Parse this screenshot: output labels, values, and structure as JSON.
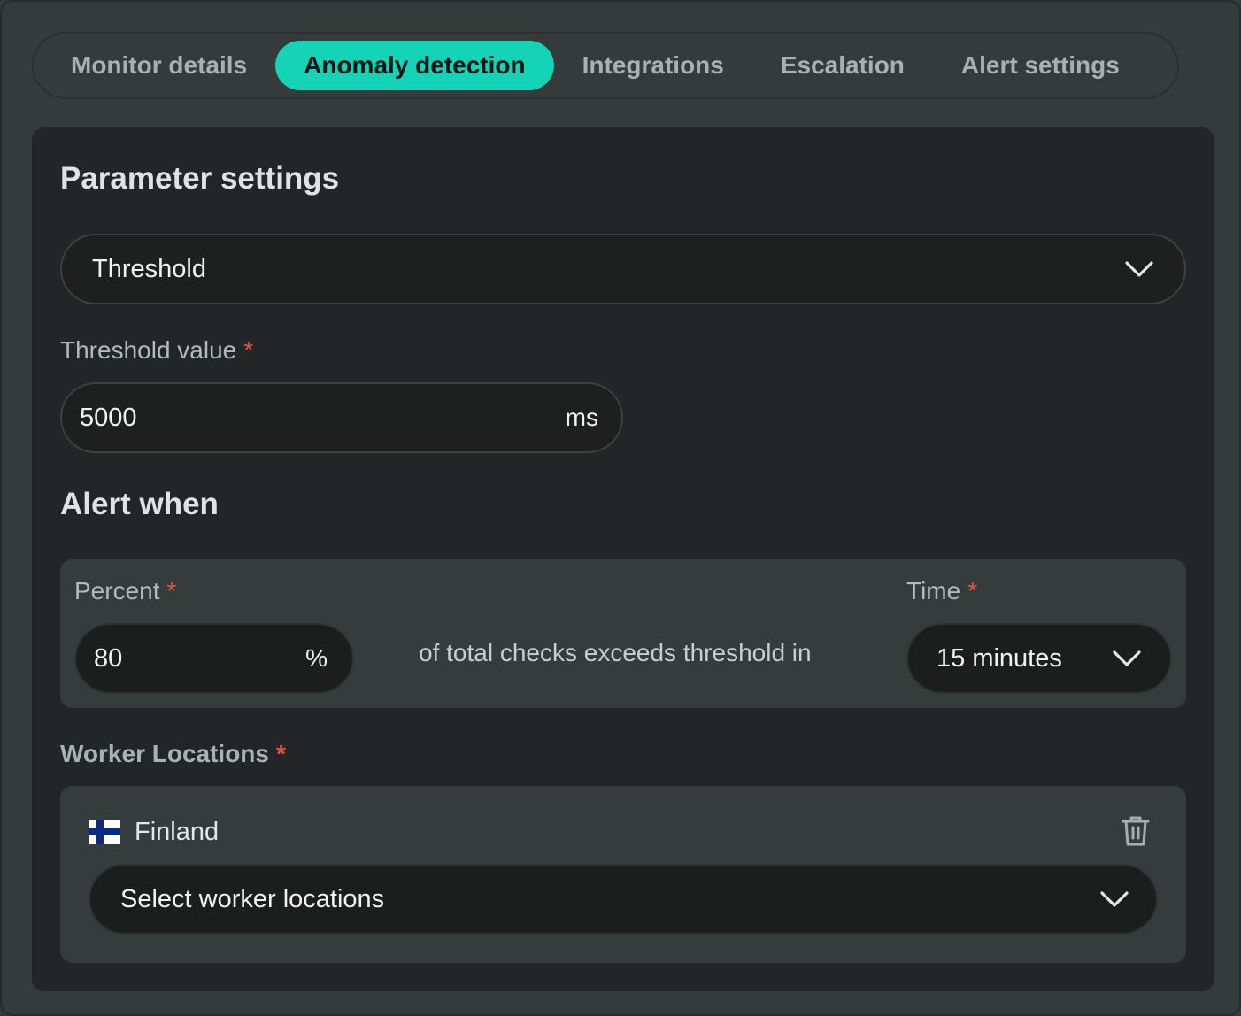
{
  "tabs": [
    {
      "label": "Monitor details",
      "active": false
    },
    {
      "label": "Anomaly detection",
      "active": true
    },
    {
      "label": "Integrations",
      "active": false
    },
    {
      "label": "Escalation",
      "active": false
    },
    {
      "label": "Alert settings",
      "active": false
    }
  ],
  "parameters": {
    "heading": "Parameter settings",
    "type_select_value": "Threshold",
    "threshold_label": "Threshold value",
    "threshold_value": "5000",
    "threshold_unit": "ms",
    "required_mark": "*"
  },
  "alert": {
    "heading": "Alert when",
    "percent_label": "Percent",
    "percent_value": "80",
    "percent_unit": "%",
    "middle_text": "of total checks exceeds threshold in",
    "time_label": "Time",
    "time_value": "15 minutes"
  },
  "workers": {
    "label": "Worker Locations",
    "selected": [
      {
        "name": "Finland",
        "flag": "finland-flag"
      }
    ],
    "select_placeholder": "Select worker locations"
  },
  "colors": {
    "accent": "#14d3b7",
    "required": "#e8543b",
    "panel": "#232626",
    "background": "#333b3b"
  }
}
